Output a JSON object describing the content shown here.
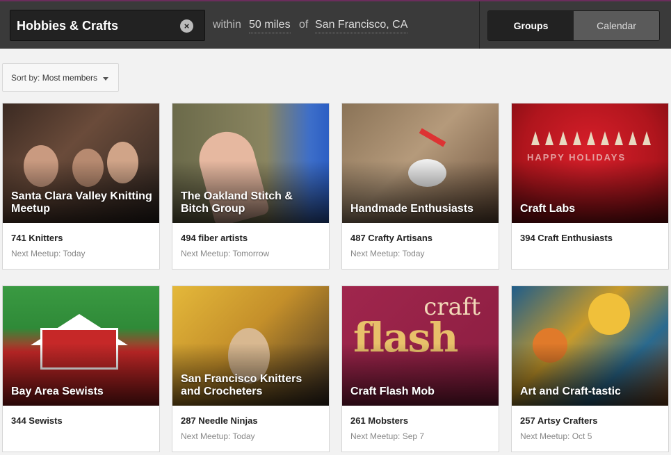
{
  "search": {
    "query": "Hobbies & Crafts",
    "within_label": "within",
    "distance": "50 miles",
    "of_label": "of",
    "location": "San Francisco, CA"
  },
  "view_toggle": {
    "groups": "Groups",
    "calendar": "Calendar",
    "active": "Groups"
  },
  "sort": {
    "label": "Sort by:",
    "value": "Most members"
  },
  "groups": [
    {
      "title": "Santa Clara Valley Knitting Meetup",
      "members": "741 Knitters",
      "next": "Next Meetup: Today"
    },
    {
      "title": "The Oakland Stitch & Bitch Group",
      "members": "494 fiber artists",
      "next": "Next Meetup: Tomorrow"
    },
    {
      "title": "Handmade Enthusiasts",
      "members": "487 Crafty Artisans",
      "next": "Next Meetup: Today"
    },
    {
      "title": "Craft Labs",
      "members": "394 Craft Enthusiasts",
      "next": ""
    },
    {
      "title": "Bay Area Sewists",
      "members": "344 Sewists",
      "next": ""
    },
    {
      "title": "San Francisco Knitters and Crocheters",
      "members": "287 Needle Ninjas",
      "next": "Next Meetup: Today"
    },
    {
      "title": "Craft Flash Mob",
      "members": "261 Mobsters",
      "next": "Next Meetup: Sep 7"
    },
    {
      "title": "Art and Craft-tastic",
      "members": "257 Artsy Crafters",
      "next": "Next Meetup: Oct 5"
    }
  ],
  "image_text": {
    "holiday": "HAPPY HOLIDAYS",
    "craft": "craft",
    "flash": "flash"
  }
}
